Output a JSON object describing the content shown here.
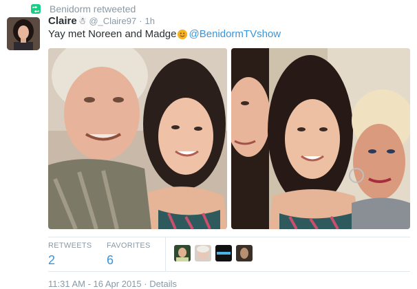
{
  "retweet": {
    "label": "Benidorm retweeted",
    "icon": "retweet-icon"
  },
  "tweet": {
    "display_name": "Claire",
    "verified_glyph": "☃",
    "screen_name": "@_Claire97",
    "separator": "·",
    "time": "1h",
    "text_before": "Yay met Noreen and Madge",
    "emoji": "smiling-face-emoji",
    "mention": "@BenidormTVshow"
  },
  "photos": [
    {
      "name": "photo-left",
      "description": "selfie"
    },
    {
      "name": "photo-right",
      "description": "selfie"
    }
  ],
  "stats": {
    "retweets_label": "RETWEETS",
    "retweets_value": "2",
    "favorites_label": "FAVORITES",
    "favorites_value": "6"
  },
  "footer": {
    "timestamp": "11:31 AM - 16 Apr 2015",
    "separator": "·",
    "details": "Details"
  },
  "colors": {
    "accent": "#3b94d9",
    "muted": "#8899a6",
    "retweet_green": "#19cf86"
  }
}
